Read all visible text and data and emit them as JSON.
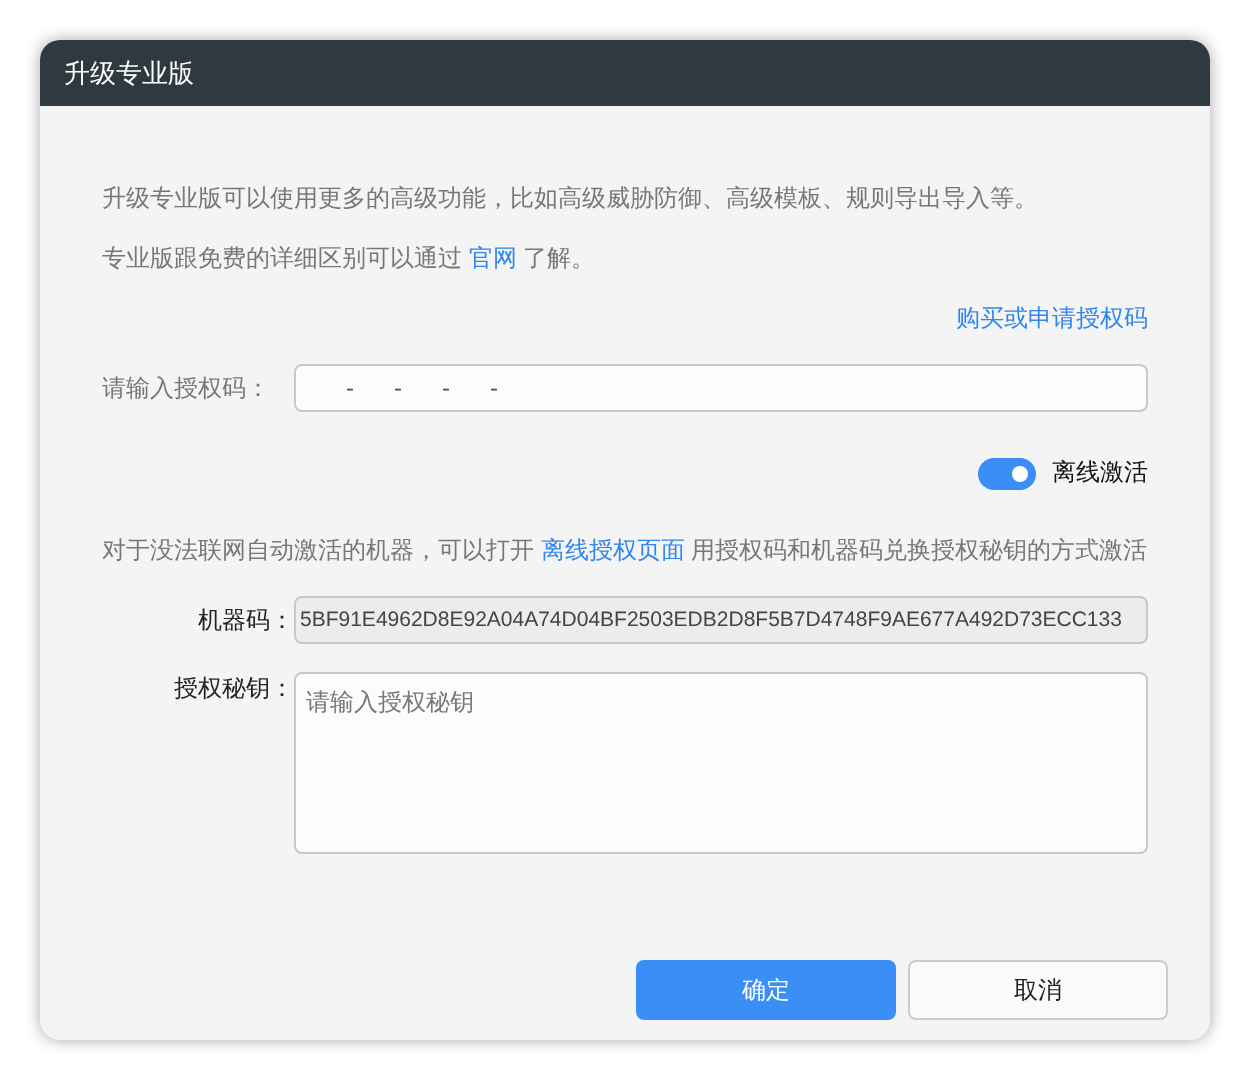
{
  "window": {
    "title": "升级专业版"
  },
  "intro": [
    "升级专业版可以使用更多的高级功能，比如高级威胁防御、高级模板、规则导出导入等。"
  ],
  "compare": {
    "before": "专业版跟免费的详细区别可以通过",
    "link": "官网",
    "after": "了解。"
  },
  "buy_link": "购买或申请授权码",
  "license": {
    "label": "请输入授权码：",
    "value": "      -      -      -      -"
  },
  "offline": {
    "label": "离线激活",
    "on": true
  },
  "offline_note": {
    "before": "对于没法联网自动激活的机器，可以打开",
    "link": "离线授权页面",
    "after": "用授权码和机器码兑换授权秘钥的方式激活"
  },
  "machine_code": {
    "label": "机器码：",
    "value": "5BF91E4962D8E92A04A74D04BF2503EDB2D8F5B7D4748F9AE677A492D73ECC133"
  },
  "secret": {
    "label": "授权秘钥：",
    "placeholder": "请输入授权秘钥"
  },
  "buttons": [
    {
      "label": "确定",
      "kind": "primary"
    },
    {
      "label": "取消",
      "kind": "secondary"
    }
  ]
}
